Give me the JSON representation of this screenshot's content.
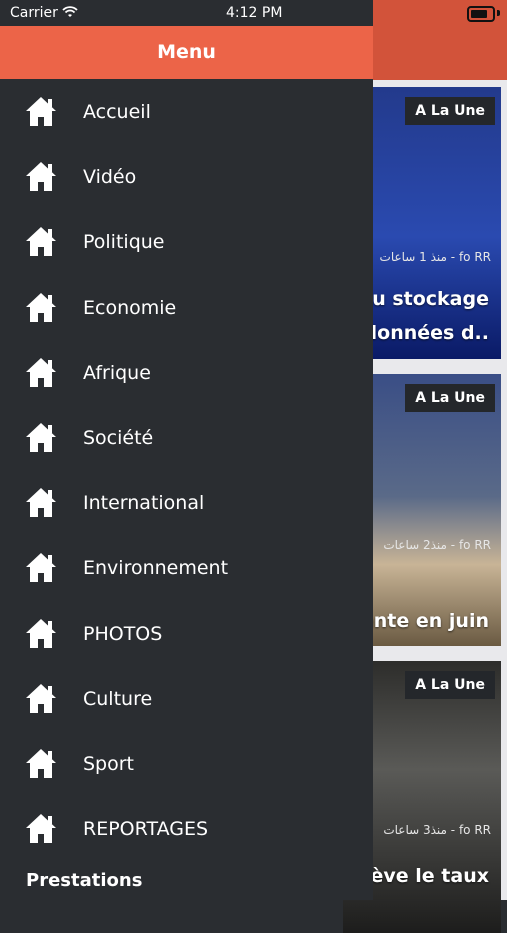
{
  "status_bar": {
    "carrier": "Carrier",
    "time": "4:12 PM"
  },
  "drawer": {
    "title": "Menu",
    "items": [
      {
        "label": "Accueil",
        "icon": "home-icon"
      },
      {
        "label": "Vidéo",
        "icon": "home-icon"
      },
      {
        "label": "Politique",
        "icon": "home-icon"
      },
      {
        "label": "Economie",
        "icon": "home-icon"
      },
      {
        "label": "Afrique",
        "icon": "home-icon"
      },
      {
        "label": "Société",
        "icon": "home-icon"
      },
      {
        "label": "International",
        "icon": "home-icon"
      },
      {
        "label": "Environnement",
        "icon": "home-icon"
      },
      {
        "label": "PHOTOS",
        "icon": "home-icon"
      },
      {
        "label": "Culture",
        "icon": "home-icon"
      },
      {
        "label": "Sport",
        "icon": "home-icon"
      },
      {
        "label": "REPORTAGES",
        "icon": "home-icon"
      }
    ],
    "section_label": "Prestations"
  },
  "background": {
    "header_color": "#d2533a",
    "cards": [
      {
        "badge": "A La Une",
        "meta": "منذ 1 ساعات - fo RR",
        "headline_line1": "du stockage",
        "headline_line2": "e données d.."
      },
      {
        "badge": "A La Une",
        "meta": "منذ2 ساعات - fo RR",
        "headline_line1": "nente en juin"
      },
      {
        "badge": "A La Une",
        "meta": "منذ3 ساعات - fo RR",
        "headline_line1": "elève le taux"
      }
    ]
  },
  "colors": {
    "accent": "#ec6448",
    "drawer_bg": "#2a2d31",
    "text": "#ffffff"
  }
}
